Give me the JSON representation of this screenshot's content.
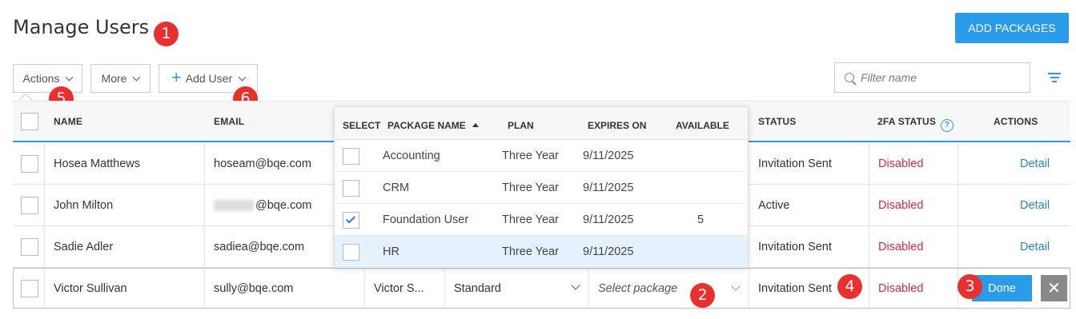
{
  "page": {
    "title": "Manage Users",
    "add_packages_label": "ADD PACKAGES"
  },
  "badges": [
    "1",
    "2",
    "3",
    "4",
    "5",
    "6"
  ],
  "toolbar": {
    "actions_label": "Actions",
    "more_label": "More",
    "add_user_label": "Add User",
    "filter_placeholder": "Filter name"
  },
  "table": {
    "headers": {
      "name": "NAME",
      "email": "EMAIL",
      "status": "STATUS",
      "twofa": "2FA STATUS",
      "actions": "ACTIONS"
    },
    "rows": [
      {
        "name": "Hosea Matthews",
        "email": "hoseam@bqe.com",
        "status": "Invitation Sent",
        "twofa": "Disabled",
        "action": "Detail"
      },
      {
        "name": "John Milton",
        "email": "@bqe.com",
        "status": "Active",
        "twofa": "Disabled",
        "action": "Detail"
      },
      {
        "name": "Sadie Adler",
        "email": "sadiea@bqe.com",
        "status": "Invitation Sent",
        "twofa": "Disabled",
        "action": "Detail"
      }
    ],
    "edit_row": {
      "name": "Victor Sullivan",
      "email": "sully@bqe.com",
      "display": "Victor S...",
      "role": "Standard",
      "package_placeholder": "Select package",
      "status": "Invitation Sent",
      "twofa": "Disabled",
      "done_label": "Done",
      "close_label": "✕"
    }
  },
  "packages": {
    "headers": {
      "select": "SELECT",
      "name": "PACKAGE NAME",
      "plan": "PLAN",
      "expires": "EXPIRES ON",
      "available": "AVAILABLE"
    },
    "rows": [
      {
        "name": "Accounting",
        "plan": "Three Year",
        "expires": "9/11/2025",
        "available": "",
        "checked": false
      },
      {
        "name": "CRM",
        "plan": "Three Year",
        "expires": "9/11/2025",
        "available": "",
        "checked": false
      },
      {
        "name": "Foundation User",
        "plan": "Three Year",
        "expires": "9/11/2025",
        "available": "5",
        "checked": true
      },
      {
        "name": "HR",
        "plan": "Three Year",
        "expires": "9/11/2025",
        "available": "",
        "checked": false
      }
    ]
  },
  "colors": {
    "accent": "#2a9be9",
    "badge": "#e8312f",
    "disabled_text": "#e0264a"
  }
}
